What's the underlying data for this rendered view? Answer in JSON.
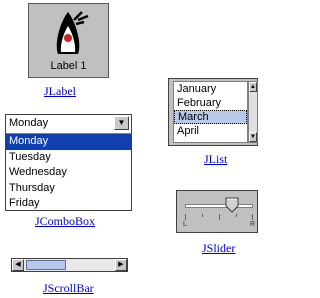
{
  "jlabel": {
    "label_text": "Label 1",
    "caption": "JLabel",
    "image": "duke-mascot-icon"
  },
  "jlist": {
    "caption": "JList",
    "items": [
      "January",
      "February",
      "March",
      "April"
    ],
    "selected": "March"
  },
  "jcombobox": {
    "caption": "JComboBox",
    "value": "Monday",
    "options": [
      "Monday",
      "Tuesday",
      "Wednesday",
      "Thursday",
      "Friday"
    ],
    "highlighted": "Monday"
  },
  "jslider": {
    "caption": "JSlider",
    "value_fraction": 0.75,
    "left_label": "L",
    "right_label": "R"
  },
  "jscrollbar": {
    "caption": "JScrollBar",
    "thumb_fraction_start": 0.0,
    "thumb_fraction_size": 0.4
  },
  "colors": {
    "link": "#0000cc",
    "selection": "#1040b0",
    "list_selection": "#b8c8e8",
    "panel": "#c0c0c0"
  }
}
